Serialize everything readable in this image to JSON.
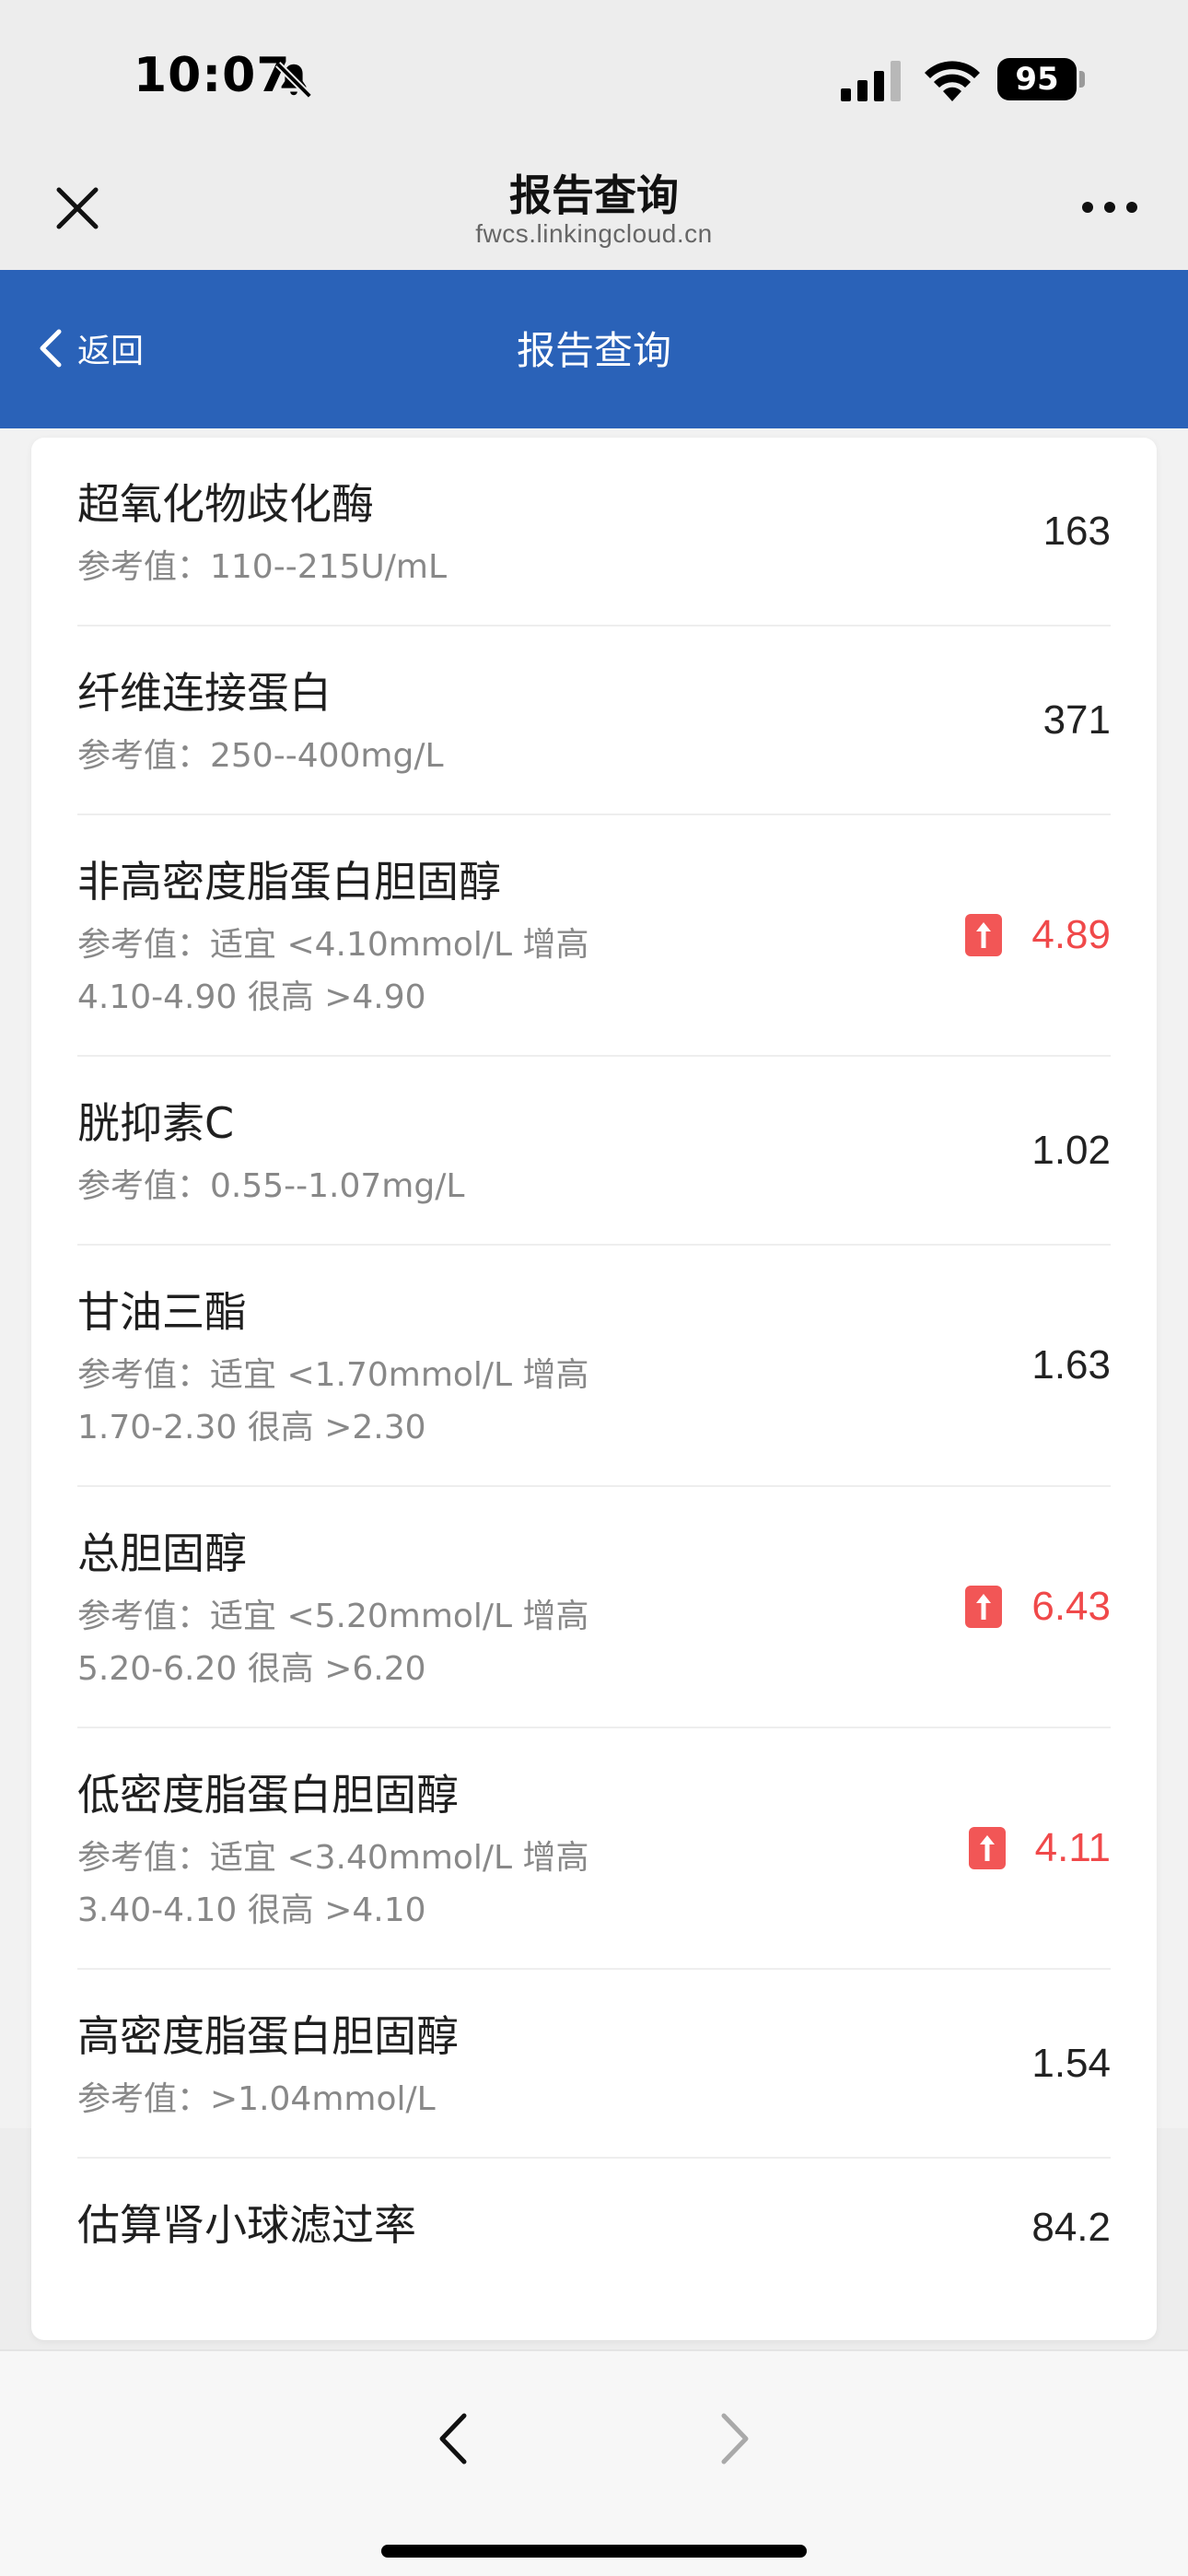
{
  "status_bar": {
    "time": "10:07",
    "battery": "95",
    "icons": [
      "bell-slash-icon",
      "signal-icon",
      "wifi-icon",
      "battery-icon"
    ]
  },
  "browser_header": {
    "title": "报告查询",
    "url": "fwcs.linkingcloud.cn",
    "icons": [
      "close-icon",
      "more-icon"
    ]
  },
  "nav": {
    "back_label": "返回",
    "title": "报告查询",
    "color": "#2A62B8"
  },
  "results": [
    {
      "name": "超氧化物歧化酶",
      "ref": "参考值：110--215U/mL",
      "value": "163",
      "high": false
    },
    {
      "name": "纤维连接蛋白",
      "ref": "参考值：250--400mg/L",
      "value": "371",
      "high": false
    },
    {
      "name": "非高密度脂蛋白胆固醇",
      "ref": "参考值：适宜 <4.10mmol/L 增高 4.10-4.90 很高 >4.90",
      "value": "4.89",
      "high": true
    },
    {
      "name": "胱抑素C",
      "ref": "参考值：0.55--1.07mg/L",
      "value": "1.02",
      "high": false
    },
    {
      "name": "甘油三酯",
      "ref": "参考值：适宜 <1.70mmol/L 增高 1.70-2.30 很高 >2.30",
      "value": "1.63",
      "high": false
    },
    {
      "name": "总胆固醇",
      "ref": "参考值：适宜 <5.20mmol/L 增高 5.20-6.20 很高 >6.20",
      "value": "6.43",
      "high": true
    },
    {
      "name": "低密度脂蛋白胆固醇",
      "ref": "参考值：适宜 <3.40mmol/L 增高 3.40-4.10 很高 >4.10",
      "value": "4.11",
      "high": true
    },
    {
      "name": "高密度脂蛋白胆固醇",
      "ref": "参考值：>1.04mmol/L",
      "value": "1.54",
      "high": false
    },
    {
      "name": "估算肾小球滤过率",
      "ref": "",
      "value": "84.2",
      "high": false
    }
  ],
  "colors": {
    "high_value": "#F0494A",
    "high_badge": "#F25656"
  },
  "bottom_bar": {
    "icons": [
      "prev-icon",
      "next-icon"
    ]
  }
}
